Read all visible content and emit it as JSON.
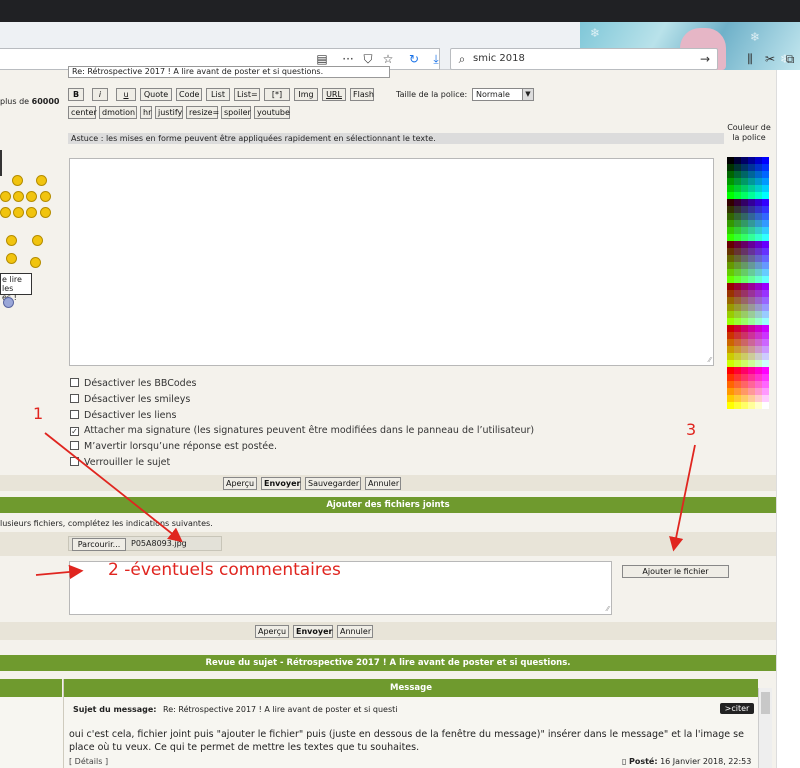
{
  "browser": {
    "search_value": "smic 2018",
    "icons": [
      "reader-icon",
      "more-icon",
      "pocket-icon",
      "bookmark-star-icon",
      "reload-icon",
      "download-icon",
      "arrow-icon",
      "library-icon",
      "scissors-icon",
      "copy-icon"
    ]
  },
  "sidebar": {
    "text_prefix": "plus de",
    "text_number": "60000",
    "note_line1": "e lire les",
    "note_line2": "es !"
  },
  "editor": {
    "subject_value": "Re: Rétrospective 2017 ! A lire avant de poster et si questions.",
    "format_buttons": [
      "B",
      "i",
      "u",
      "Quote",
      "Code",
      "List",
      "List=",
      "[*]",
      "Img",
      "URL",
      "Flash"
    ],
    "font_size_label": "Taille de la police:",
    "font_size_value": "Normale",
    "extra_buttons": [
      "center",
      "dmotion",
      "hr",
      "justify",
      "resize=",
      "spoiler",
      "youtube"
    ],
    "tip": "Astuce : les mises en forme peuvent être appliquées rapidement en sélectionnant le texte.",
    "color_label": "Couleur de la police",
    "palette_colors": [
      "#000000",
      "#000033",
      "#000066",
      "#000099",
      "#0000cc",
      "#0000ff",
      "#003300",
      "#003333",
      "#003366",
      "#003399",
      "#0033cc",
      "#0033ff",
      "#006600",
      "#006633",
      "#006666",
      "#006699",
      "#0066cc",
      "#0066ff",
      "#009900",
      "#009933",
      "#009966",
      "#009999",
      "#0099cc",
      "#0099ff",
      "#00cc00",
      "#00cc33",
      "#00cc66",
      "#00cc99",
      "#00cccc",
      "#00ccff",
      "#00ff00",
      "#00ff33",
      "#00ff66",
      "#00ff99",
      "#00ffcc",
      "#00ffff",
      "#330000",
      "#330033",
      "#330066",
      "#330099",
      "#3300cc",
      "#3300ff",
      "#333300",
      "#333333",
      "#333366",
      "#333399",
      "#3333cc",
      "#3333ff",
      "#336600",
      "#336633",
      "#336666",
      "#336699",
      "#3366cc",
      "#3366ff",
      "#339900",
      "#339933",
      "#339966",
      "#339999",
      "#3399cc",
      "#3399ff",
      "#33cc00",
      "#33cc33",
      "#33cc66",
      "#33cc99",
      "#33cccc",
      "#33ccff",
      "#33ff00",
      "#33ff33",
      "#33ff66",
      "#33ff99",
      "#33ffcc",
      "#33ffff",
      "#660000",
      "#660033",
      "#660066",
      "#660099",
      "#6600cc",
      "#6600ff",
      "#663300",
      "#663333",
      "#663366",
      "#663399",
      "#6633cc",
      "#6633ff",
      "#666600",
      "#666633",
      "#666666",
      "#666699",
      "#6666cc",
      "#6666ff",
      "#669900",
      "#669933",
      "#669966",
      "#669999",
      "#6699cc",
      "#6699ff",
      "#66cc00",
      "#66cc33",
      "#66cc66",
      "#66cc99",
      "#66cccc",
      "#66ccff",
      "#66ff00",
      "#66ff33",
      "#66ff66",
      "#66ff99",
      "#66ffcc",
      "#66ffff",
      "#990000",
      "#990033",
      "#990066",
      "#990099",
      "#9900cc",
      "#9900ff",
      "#993300",
      "#993333",
      "#993366",
      "#993399",
      "#9933cc",
      "#9933ff",
      "#996600",
      "#996633",
      "#996666",
      "#996699",
      "#9966cc",
      "#9966ff",
      "#999900",
      "#999933",
      "#999966",
      "#999999",
      "#9999cc",
      "#9999ff",
      "#99cc00",
      "#99cc33",
      "#99cc66",
      "#99cc99",
      "#99cccc",
      "#99ccff",
      "#99ff00",
      "#99ff33",
      "#99ff66",
      "#99ff99",
      "#99ffcc",
      "#99ffff",
      "#cc0000",
      "#cc0033",
      "#cc0066",
      "#cc0099",
      "#cc00cc",
      "#cc00ff",
      "#cc3300",
      "#cc3333",
      "#cc3366",
      "#cc3399",
      "#cc33cc",
      "#cc33ff",
      "#cc6600",
      "#cc6633",
      "#cc6666",
      "#cc6699",
      "#cc66cc",
      "#cc66ff",
      "#cc9900",
      "#cc9933",
      "#cc9966",
      "#cc9999",
      "#cc99cc",
      "#cc99ff",
      "#cccc00",
      "#cccc33",
      "#cccc66",
      "#cccc99",
      "#cccccc",
      "#ccccff",
      "#ccff00",
      "#ccff33",
      "#ccff66",
      "#ccff99",
      "#ccffcc",
      "#ccffff",
      "#ff0000",
      "#ff0033",
      "#ff0066",
      "#ff0099",
      "#ff00cc",
      "#ff00ff",
      "#ff3300",
      "#ff3333",
      "#ff3366",
      "#ff3399",
      "#ff33cc",
      "#ff33ff",
      "#ff6600",
      "#ff6633",
      "#ff6666",
      "#ff6699",
      "#ff66cc",
      "#ff66ff",
      "#ff9900",
      "#ff9933",
      "#ff9966",
      "#ff9999",
      "#ff99cc",
      "#ff99ff",
      "#ffcc00",
      "#ffcc33",
      "#ffcc66",
      "#ffcc99",
      "#ffcccc",
      "#ffccff",
      "#ffff00",
      "#ffff33",
      "#ffff66",
      "#ffff99",
      "#ffffcc",
      "#ffffff"
    ],
    "options": [
      {
        "label": "Désactiver les BBCodes",
        "checked": false
      },
      {
        "label": "Désactiver les smileys",
        "checked": false
      },
      {
        "label": "Désactiver les liens",
        "checked": false
      },
      {
        "label": "Attacher ma signature (les signatures peuvent être modifiées dans le panneau de l’utilisateur)",
        "checked": true
      },
      {
        "label": "M’avertir lorsqu’une réponse est postée.",
        "checked": false
      },
      {
        "label": "Verrouiller le sujet",
        "checked": false
      }
    ],
    "actions": [
      "Aperçu",
      "Envoyer",
      "Sauvegarder",
      "Annuler"
    ]
  },
  "attachments": {
    "header": "Ajouter des fichiers joints",
    "instruction": "lusieurs fichiers, complétez les indications suivantes.",
    "browse_label": "Parcourir...",
    "file_name": "P05A8093.jpg",
    "add_button": "Ajouter le fichier",
    "actions": [
      "Aperçu",
      "Envoyer",
      "Annuler"
    ]
  },
  "annotations": {
    "n1": "1",
    "n2": "2 -éventuels commentaires",
    "n3": "3",
    "color": "#e0251f"
  },
  "review": {
    "header": "Revue du sujet - Rétrospective 2017 ! A lire avant de poster et si questions.",
    "col_message": "Message",
    "subject_label": "Sujet du message:",
    "subject_value": "Re: Rétrospective 2017 ! A lire avant de poster et si questi",
    "quote_button": ">citer",
    "body": "oui c'est cela, fichier joint puis \"ajouter le fichier\" puis (juste en dessous de la fenêtre du message)\" insérer dans le message\" et la l'image se place où tu veux. Ce qui te permet de mettre les textes que tu souhaites.",
    "details": "[ Détails ]",
    "posted_label": "Posté:",
    "posted_value": "16 Janvier 2018, 22:53"
  }
}
